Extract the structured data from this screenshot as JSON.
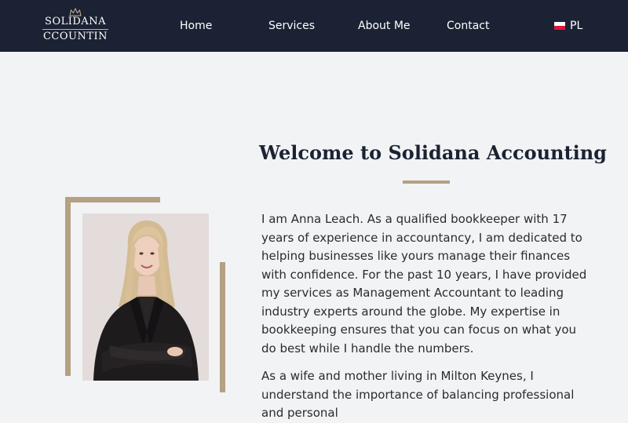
{
  "header": {
    "logo": {
      "line1": "SOLIDANA",
      "line2": "CCOUNTIN",
      "icon": "crown-icon"
    },
    "nav": {
      "home": "Home",
      "services": "Services",
      "about": "About Me",
      "contact": "Contact"
    },
    "language": {
      "label": "PL",
      "icon": "poland-flag-icon"
    }
  },
  "main": {
    "title": "Welcome to Solidana Accounting",
    "paragraphs": [
      "I am Anna Leach. As a qualified bookkeeper with 17 years of experience in accountancy, I am dedicated to helping businesses like yours manage their finances with confidence. For the past 10 years, I have provided my services as Management Accountant to leading industry experts around the globe. My expertise in bookkeeping ensures that you can focus on what you do best while I handle the numbers.",
      "As a wife and mother living in Milton Keynes, I understand the importance of balancing professional and personal"
    ]
  },
  "colors": {
    "header_bg": "#1b2233",
    "page_bg": "#f2f3f5",
    "accent_gold": "#b4a082",
    "title_text": "#1b2233",
    "body_text": "#2b2b2b"
  }
}
